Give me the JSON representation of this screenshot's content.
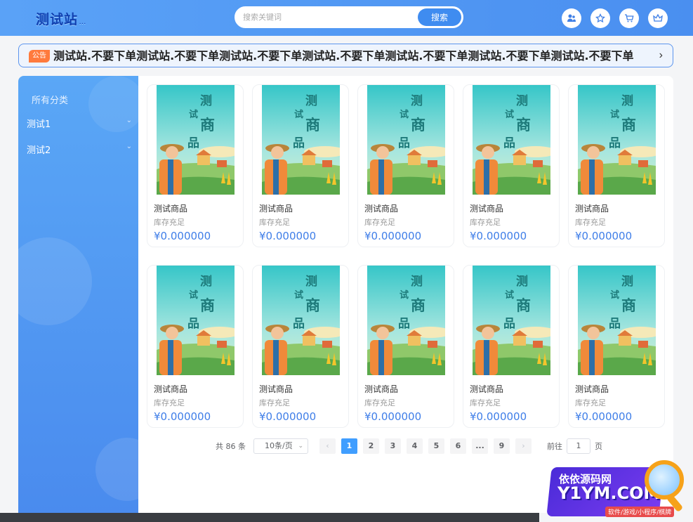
{
  "header": {
    "logo": "测试站",
    "logo_small": "...",
    "search_placeholder": "搜索关键词",
    "search_button": "搜索",
    "icons": [
      "user-group-icon",
      "star-icon",
      "cart-icon",
      "crown-icon"
    ]
  },
  "notice": {
    "tag": "公告",
    "text": "测试站.不要下单测试站.不要下单测试站.不要下单测试站.不要下单测试站.不要下单测试站.不要下单测试站.不要下单"
  },
  "sidebar": {
    "title": "所有分类",
    "items": [
      {
        "label": "测试1"
      },
      {
        "label": "测试2"
      }
    ]
  },
  "products": [
    {
      "name": "测试商品",
      "stock": "库存充足",
      "price": "¥0.000000"
    },
    {
      "name": "测试商品",
      "stock": "库存充足",
      "price": "¥0.000000"
    },
    {
      "name": "测试商品",
      "stock": "库存充足",
      "price": "¥0.000000"
    },
    {
      "name": "测试商品",
      "stock": "库存充足",
      "price": "¥0.000000"
    },
    {
      "name": "测试商品",
      "stock": "库存充足",
      "price": "¥0.000000"
    },
    {
      "name": "测试商品",
      "stock": "库存充足",
      "price": "¥0.000000"
    },
    {
      "name": "测试商品",
      "stock": "库存充足",
      "price": "¥0.000000"
    },
    {
      "name": "测试商品",
      "stock": "库存充足",
      "price": "¥0.000000"
    },
    {
      "name": "测试商品",
      "stock": "库存充足",
      "price": "¥0.000000"
    },
    {
      "name": "测试商品",
      "stock": "库存充足",
      "price": "¥0.000000"
    }
  ],
  "product_image_text": {
    "a": "测",
    "b": "试",
    "c": "商",
    "d": "品"
  },
  "pagination": {
    "total": "共 86 条",
    "page_size": "10条/页",
    "pages": [
      "1",
      "2",
      "3",
      "4",
      "5",
      "6",
      "...",
      "9"
    ],
    "current": "1",
    "prev": "‹",
    "next": "›",
    "goto_label": "前往",
    "goto_value": "1",
    "goto_suffix": "页"
  },
  "watermark": {
    "line1": "依依源码网",
    "line2": "Y1YM.COM",
    "line3": "软件/游戏/小程序/棋牌"
  },
  "colors": {
    "header_blue": "#4a8ff0",
    "accent_blue": "#409eff",
    "price_blue": "#3f7ee8",
    "notice_tag": "#ff7a3d"
  }
}
